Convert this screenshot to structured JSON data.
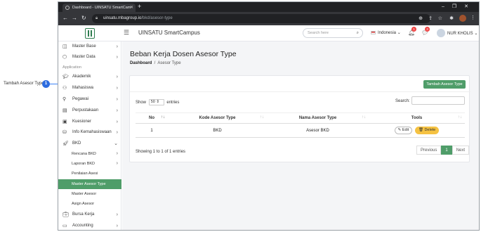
{
  "callout": {
    "label": "Tambah Asesor Type",
    "number": "1"
  },
  "browser": {
    "tab_title": "Dashboard - UINSATU SmartCam",
    "url_host": "uinsatu.mbagroup.io",
    "url_path": "/bkd/asesor-type"
  },
  "header": {
    "brand": "UINSATU SmartCampus",
    "search_placeholder": "Search here",
    "language": "Indonesia",
    "notif_count": "1",
    "message_count": "3",
    "user_name": "NUR KHOLIS"
  },
  "sidebar": {
    "section_application": "Application",
    "items": [
      {
        "label": "Master Base",
        "icon": "layers-icon"
      },
      {
        "label": "Master Data",
        "icon": "cube-icon"
      },
      {
        "label": "Akademik",
        "icon": "graduation-cap-icon"
      },
      {
        "label": "Mahasiswa",
        "icon": "users-icon"
      },
      {
        "label": "Pegawai",
        "icon": "user-icon"
      },
      {
        "label": "Perpustakaan",
        "icon": "book-icon"
      },
      {
        "label": "Kuesioner",
        "icon": "clipboard-icon"
      },
      {
        "label": "Info Kemahasiswaan",
        "icon": "database-icon"
      },
      {
        "label": "BKD",
        "icon": "rocket-icon"
      },
      {
        "label": "Bursa Kerja",
        "icon": "briefcase-icon"
      },
      {
        "label": "Accounting",
        "icon": "wallet-icon"
      }
    ],
    "bkd_sub": [
      {
        "label": "Rencana BKD"
      },
      {
        "label": "Laporan BKD"
      },
      {
        "label": "Penilaian Asesi"
      },
      {
        "label": "Master Asesor Type"
      },
      {
        "label": "Master Asesor"
      },
      {
        "label": "Asign Asesor"
      }
    ]
  },
  "page": {
    "title": "Beban Kerja Dosen Asesor Type",
    "breadcrumb_root": "Dashboard",
    "breadcrumb_current": "Asesor Type",
    "add_button": "Tambah Asesor Type",
    "show_label": "Show",
    "entries_value": "50",
    "entries_label": "entries",
    "search_label": "Search:"
  },
  "table": {
    "headers": [
      "No",
      "Kode Asesor Type",
      "Nama Asesor Type",
      "Tools"
    ],
    "rows": [
      {
        "no": "1",
        "kode": "BKD",
        "nama": "Asesor BKD"
      }
    ],
    "edit_label": "Edit",
    "delete_label": "Delete"
  },
  "footer": {
    "showing_text": "Showing 1 to 1 of 1 entries",
    "prev": "Previous",
    "page": "1",
    "next": "Next"
  }
}
